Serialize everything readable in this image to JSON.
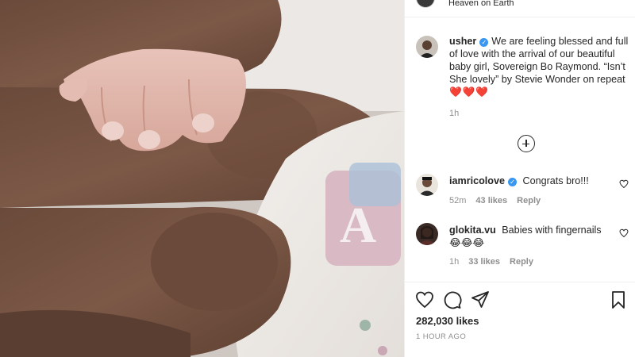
{
  "post": {
    "location": "Heaven on Earth",
    "caption": {
      "username": "usher",
      "text": "We are feeling blessed and full of love with the arrival of our beautiful baby girl, Sovereign Bo Raymond. “Isn’t She lovely” by Stevie Wonder on repeat",
      "emoji": "❤️❤️❤️",
      "time": "1h"
    },
    "comments": [
      {
        "username": "iamricolove",
        "verified": true,
        "text": "Congrats bro!!!",
        "time": "52m",
        "likes": "43 likes",
        "reply": "Reply"
      },
      {
        "username": "glokita.vu",
        "verified": false,
        "text": "Babies with fingernails",
        "emoji": "😂😂😂",
        "time": "1h",
        "likes": "33 likes",
        "reply": "Reply"
      }
    ],
    "likes_count": "282,030 likes",
    "posted_ago": "1 HOUR AGO"
  },
  "icons": {
    "verified": "verified-badge-icon",
    "load_more": "plus-circle-icon",
    "like": "heart-icon",
    "comment": "comment-icon",
    "share": "paper-plane-icon",
    "save": "bookmark-icon"
  },
  "colors": {
    "verified_blue": "#3897f0",
    "heart_red": "#ed4956",
    "muted_text": "#8e8e8e"
  }
}
